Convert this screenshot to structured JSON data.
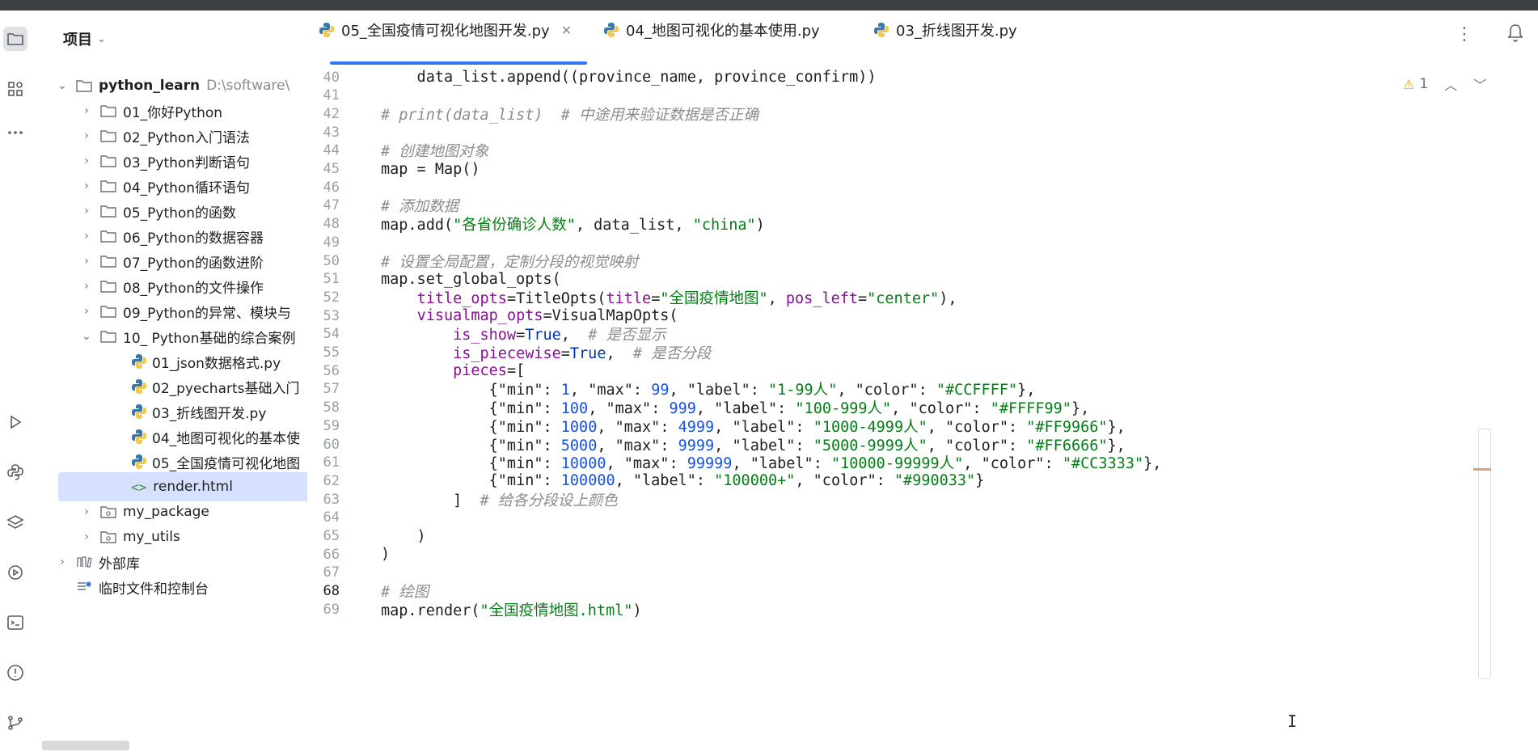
{
  "panel": {
    "title": "项目",
    "root": {
      "name": "python_learn",
      "path": "D:\\software\\"
    },
    "items": [
      {
        "label": "01_你好Python"
      },
      {
        "label": "02_Python入门语法"
      },
      {
        "label": "03_Python判断语句"
      },
      {
        "label": "04_Python循环语句"
      },
      {
        "label": "05_Python的函数"
      },
      {
        "label": "06_Python的数据容器"
      },
      {
        "label": "07_Python的函数进阶"
      },
      {
        "label": "08_Python的文件操作"
      },
      {
        "label": "09_Python的异常、模块与"
      },
      {
        "label": "10_ Python基础的综合案例"
      }
    ],
    "files": [
      {
        "label": "01_json数据格式.py"
      },
      {
        "label": "02_pyecharts基础入门"
      },
      {
        "label": "03_折线图开发.py"
      },
      {
        "label": "04_地图可视化的基本使"
      },
      {
        "label": "05_全国疫情可视化地图"
      },
      {
        "label": "render.html"
      }
    ],
    "packages": [
      {
        "label": "my_package"
      },
      {
        "label": "my_utils"
      }
    ],
    "external": "外部库",
    "scratches": "临时文件和控制台"
  },
  "tabs": [
    {
      "label": "05_全国疫情可视化地图开发.py",
      "active": true
    },
    {
      "label": "04_地图可视化的基本使用.py"
    },
    {
      "label": "03_折线图开发.py"
    }
  ],
  "inspections": {
    "count": "1"
  },
  "editor": {
    "current_line": "68",
    "lines": [
      {
        "n": "40",
        "t": "    data_list.append((province_name, province_confirm))"
      },
      {
        "n": "41",
        "t": ""
      },
      {
        "n": "42",
        "t": "# print(data_list)  # 中途用来验证数据是否正确"
      },
      {
        "n": "43",
        "t": ""
      },
      {
        "n": "44",
        "t": "# 创建地图对象"
      },
      {
        "n": "45",
        "t": "map = Map()"
      },
      {
        "n": "46",
        "t": ""
      },
      {
        "n": "47",
        "t": "# 添加数据"
      },
      {
        "n": "48",
        "t": "map.add(\"各省份确诊人数\", data_list, \"china\")"
      },
      {
        "n": "49",
        "t": ""
      },
      {
        "n": "50",
        "t": "# 设置全局配置，定制分段的视觉映射"
      },
      {
        "n": "51",
        "t": "map.set_global_opts("
      },
      {
        "n": "52",
        "t": "    title_opts=TitleOpts(title=\"全国疫情地图\", pos_left=\"center\"),"
      },
      {
        "n": "53",
        "t": "    visualmap_opts=VisualMapOpts("
      },
      {
        "n": "54",
        "t": "        is_show=True,  # 是否显示"
      },
      {
        "n": "55",
        "t": "        is_piecewise=True,  # 是否分段"
      },
      {
        "n": "56",
        "t": "        pieces=["
      },
      {
        "n": "57",
        "t": "            {\"min\": 1, \"max\": 99, \"label\": \"1-99人\", \"color\": \"#CCFFFF\"},"
      },
      {
        "n": "58",
        "t": "            {\"min\": 100, \"max\": 999, \"label\": \"100-999人\", \"color\": \"#FFFF99\"},"
      },
      {
        "n": "59",
        "t": "            {\"min\": 1000, \"max\": 4999, \"label\": \"1000-4999人\", \"color\": \"#FF9966\"},"
      },
      {
        "n": "60",
        "t": "            {\"min\": 5000, \"max\": 9999, \"label\": \"5000-9999人\", \"color\": \"#FF6666\"},"
      },
      {
        "n": "61",
        "t": "            {\"min\": 10000, \"max\": 99999, \"label\": \"10000-99999人\", \"color\": \"#CC3333\"},"
      },
      {
        "n": "62",
        "t": "            {\"min\": 100000, \"label\": \"100000+\", \"color\": \"#990033\"}"
      },
      {
        "n": "63",
        "t": "        ]  # 给各分段设上颜色"
      },
      {
        "n": "64",
        "t": ""
      },
      {
        "n": "65",
        "t": "    )"
      },
      {
        "n": "66",
        "t": ")"
      },
      {
        "n": "67",
        "t": ""
      },
      {
        "n": "68",
        "t": "# 绘图"
      },
      {
        "n": "69",
        "t": "map.render(\"全国疫情地图.html\")"
      }
    ]
  }
}
